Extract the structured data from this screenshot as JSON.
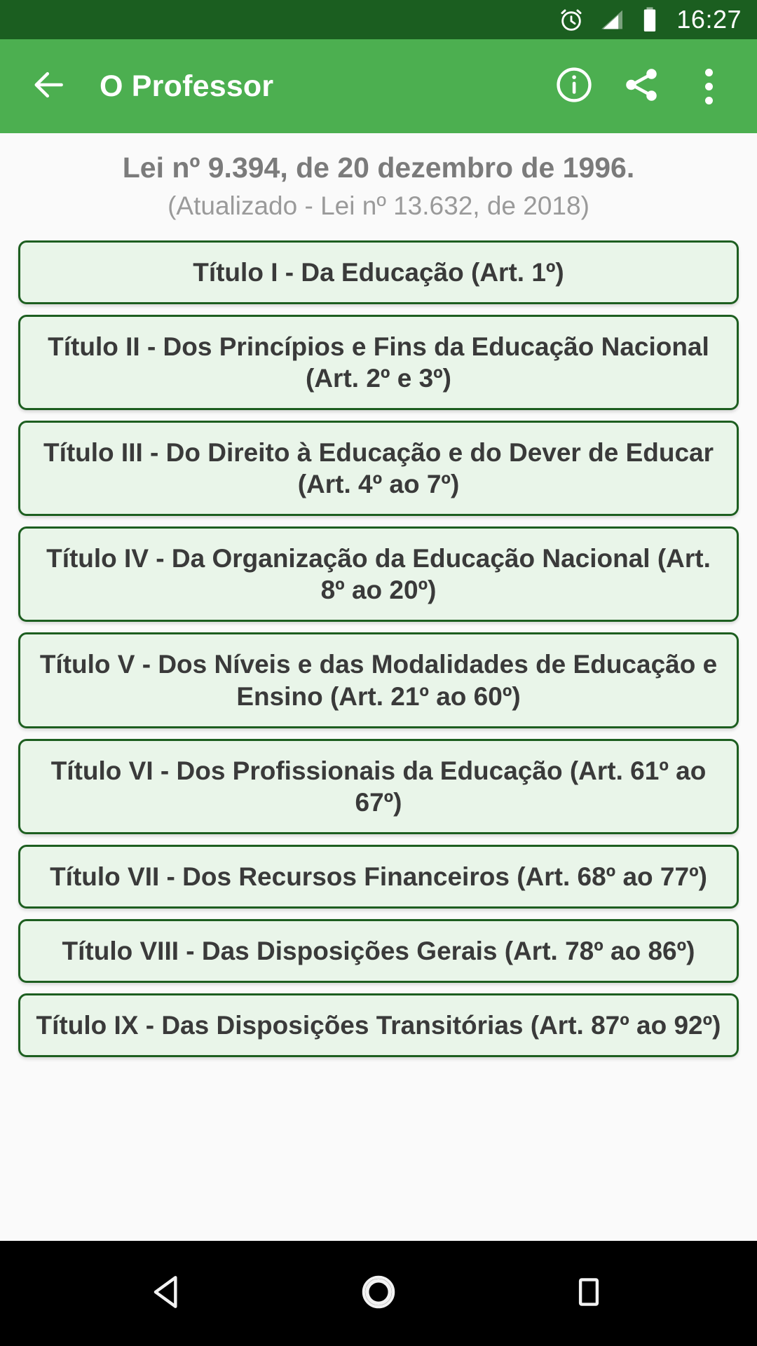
{
  "statusbar": {
    "time": "16:27",
    "icons": [
      "alarm-clock-icon",
      "signal-cellular-icon",
      "battery-full-icon"
    ],
    "background_color": "#1b5e20",
    "foreground_color": "#ffffff"
  },
  "appbar": {
    "title": "O Professor",
    "background_color": "#4caf50",
    "back_icon": "arrow-back-icon",
    "actions": [
      {
        "name": "info-icon",
        "label": "Informações"
      },
      {
        "name": "share-icon",
        "label": "Compartilhar"
      },
      {
        "name": "overflow-menu-icon",
        "label": "Mais opções"
      }
    ]
  },
  "content": {
    "law_title": "Lei nº 9.394, de 20 dezembro de 1996.",
    "law_subtitle": "(Atualizado - Lei nº 13.632, de 2018)",
    "title_color": "#7b7b7b",
    "subtitle_color": "#9a9a9a",
    "card_background": "#e9f5e9",
    "card_border": "#1d5e20",
    "card_text_color": "#3a3a3a",
    "items": [
      {
        "label": "Título I - Da Educação (Art. 1º)"
      },
      {
        "label": "Título II - Dos Princípios e Fins da Educação Nacional (Art. 2º e 3º)"
      },
      {
        "label": "Título III - Do Direito à Educação e do Dever de Educar (Art. 4º ao 7º)"
      },
      {
        "label": "Título IV - Da Organização da Educação Nacional (Art. 8º ao 20º)"
      },
      {
        "label": "Título V - Dos Níveis e das Modalidades de Educação e Ensino (Art. 21º ao 60º)"
      },
      {
        "label": "Título VI - Dos Profissionais da Educação (Art. 61º ao 67º)"
      },
      {
        "label": "Título VII - Dos Recursos Financeiros (Art. 68º ao 77º)"
      },
      {
        "label": "Título VIII - Das Disposições Gerais (Art. 78º ao 86º)"
      },
      {
        "label": "Título IX - Das Disposições Transitórias (Art. 87º ao 92º)"
      }
    ]
  },
  "navbar": {
    "background_color": "#000000",
    "buttons": [
      {
        "name": "nav-back-icon",
        "label": "Voltar"
      },
      {
        "name": "nav-home-icon",
        "label": "Início"
      },
      {
        "name": "nav-recents-icon",
        "label": "Recentes"
      }
    ]
  }
}
